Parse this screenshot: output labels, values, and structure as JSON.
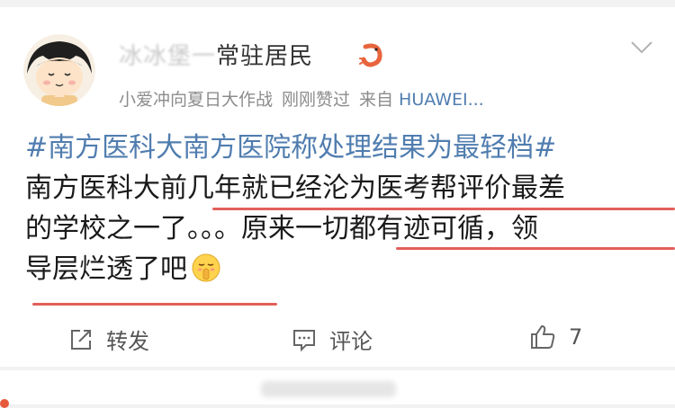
{
  "post": {
    "username_blurred": "冰冰堡一",
    "username_visible": "常驻居民",
    "meta_liked_by": "小爱冲向夏日大作战",
    "meta_liked_time": "刚刚赞过",
    "meta_source_prefix": "来自",
    "meta_source": "HUAWEI...",
    "hashtag": "#南方医科大南方医院称处理结果为最轻档#",
    "line2": "南方医科大前几年就已经沦为医考帮评价最差",
    "line3": "的学校之一了。。。原来一切都有迹可循，领",
    "line4": "导层烂透了吧"
  },
  "actions": {
    "repost_label": "转发",
    "comment_label": "评论",
    "like_count": "7"
  },
  "colors": {
    "link": "#507daf",
    "underline": "#e2605a",
    "text": "#1a1a1a",
    "meta": "#8c8c8c"
  },
  "icons": [
    "avatar",
    "shrimp-icon",
    "chevron-down-icon",
    "shush-emoji",
    "repost-icon",
    "comment-icon",
    "thumbs-up-icon"
  ]
}
